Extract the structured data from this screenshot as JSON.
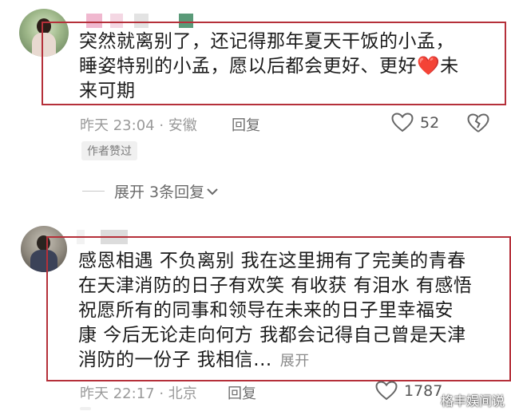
{
  "comments": [
    {
      "lines": [
        "突然就离别了，还记得那年夏天干饭的小孟，",
        "睡姿特别的小孟，愿以后都会更好、更好",
        "来可期"
      ],
      "line2_tail": "未",
      "heart": "❤️",
      "time_location": "昨天 23:04 · 安徽",
      "reply": "回复",
      "likes": "52",
      "author_liked_tag": "作者赞过"
    },
    {
      "lines": [
        "感恩相遇 不负离别 我在这里拥有了完美的青春",
        "在天津消防的日子有欢笑 有收获 有泪水 有感悟",
        "祝愿所有的同事和领导在未来的日子里幸福安",
        "康 今后无论走向何方 我都会记得自己曾是天津",
        "消防的一份子 我相信..."
      ],
      "expand": "展开",
      "time_location": "昨天 22:17 · 北京",
      "reply": "回复",
      "likes": "1787"
    }
  ],
  "expand_replies": "展开 3条回复",
  "watermark": "格丰娱间说",
  "colors": {
    "highlight_border": "#b5303a",
    "heart": "#e02e2e"
  }
}
